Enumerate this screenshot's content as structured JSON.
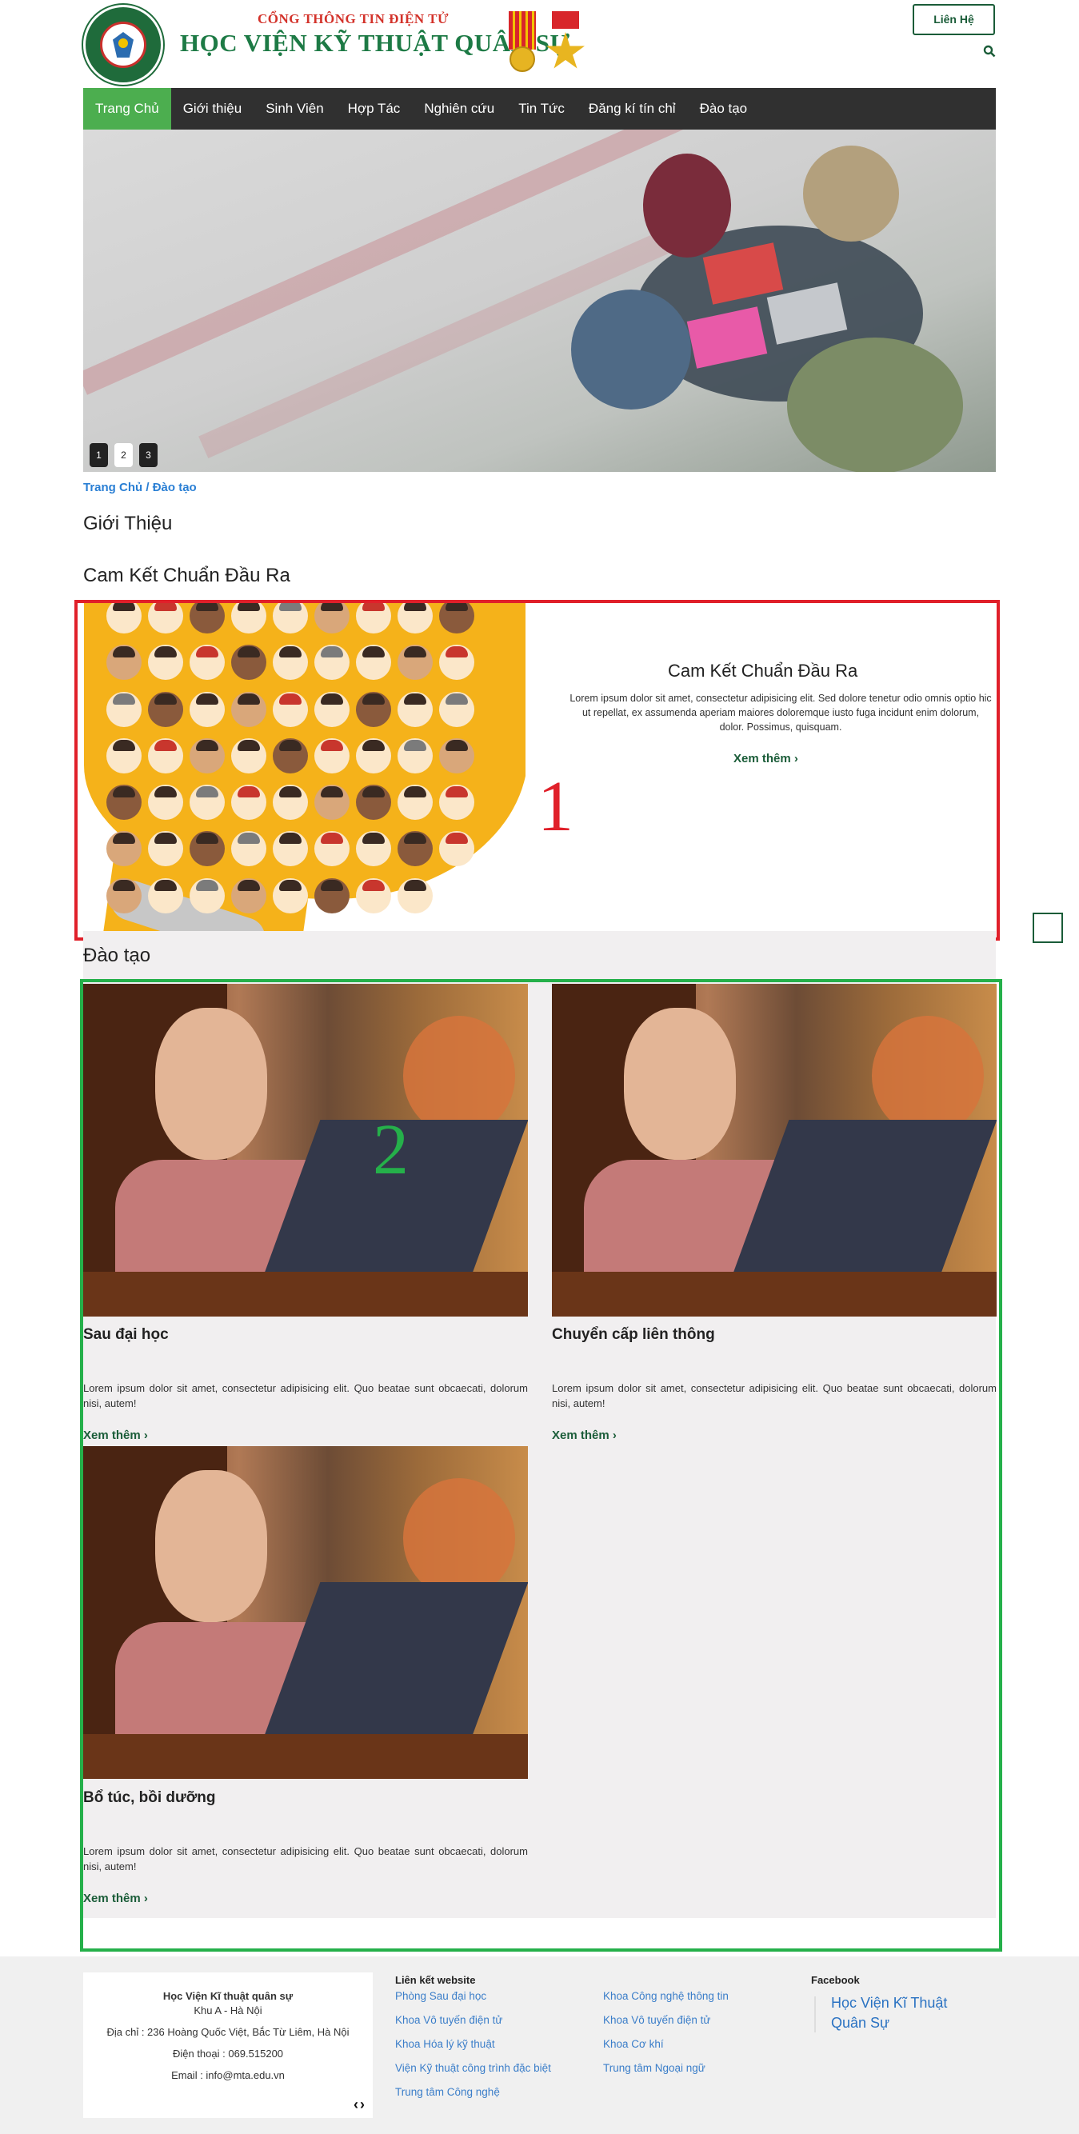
{
  "header": {
    "portal_subtitle": "CỔNG THÔNG TIN ĐIỆN TỬ",
    "portal_title": "HỌC VIỆN KỸ THUẬT QUÂN SỰ",
    "contact_button": "Liên Hệ",
    "search_icon": "search-icon"
  },
  "nav": {
    "items": [
      "Trang Chủ",
      "Giới thiệu",
      "Sinh Viên",
      "Hợp Tác",
      "Nghiên cứu",
      "Tin Tức",
      "Đăng kí tín chỉ",
      "Đào tạo"
    ],
    "active_index": 0,
    "active_color": "#4cae4f",
    "bar_color": "#303030"
  },
  "slider": {
    "pages": [
      "1",
      "2",
      "3"
    ]
  },
  "breadcrumb": {
    "home": "Trang Chủ",
    "separator": "/",
    "current": "Đào tạo"
  },
  "sections": {
    "intro_heading": "Giới Thiệu",
    "commit_heading": "Cam Kết Chuẩn Đầu Ra",
    "training_heading": "Đào tạo"
  },
  "commitment": {
    "title": "Cam Kết Chuẩn Đầu Ra",
    "text": "Lorem ipsum dolor sit amet, consectetur adipisicing elit. Sed dolore tenetur odio omnis optio hic ut repellat, ex assumenda aperiam maiores doloremque iusto fuga incidunt enim dolorum, dolor. Possimus, quisquam.",
    "more": "Xem thêm",
    "annotation": "1",
    "border_color": "#e0202a"
  },
  "training": {
    "annotation": "2",
    "border_color": "#25b04a",
    "cards": [
      {
        "title": "Sau đại học",
        "text": "Lorem ipsum dolor sit amet, consectetur adipisicing elit. Quo beatae sunt obcaecati, dolorum nisi, autem!",
        "more": "Xem thêm"
      },
      {
        "title": "Chuyển cấp liên thông",
        "text": "Lorem ipsum dolor sit amet, consectetur adipisicing elit. Quo beatae sunt obcaecati, dolorum nisi, autem!",
        "more": "Xem thêm"
      },
      {
        "title": "Bổ túc, bồi dưỡng",
        "text": "Lorem ipsum dolor sit amet, consectetur adipisicing elit. Quo beatae sunt obcaecati, dolorum nisi, autem!",
        "more": "Xem thêm"
      }
    ]
  },
  "footer": {
    "org_name": "Học Viện Kĩ thuật quân sự",
    "campus": "Khu A - Hà Nội",
    "address": "Địa chỉ : 236 Hoàng Quốc Việt, Bắc Từ Liêm, Hà Nội",
    "phone": "Điện thoại : 069.515200",
    "email": "Email : info@mta.edu.vn",
    "links_title": "Liên kết website",
    "links_col1": [
      "Phòng Sau đại học",
      "Khoa Vô tuyến điện tử",
      "Khoa Hóa lý kỹ thuật",
      "Viện Kỹ thuật công trình đặc biệt",
      "Trung tâm Công nghệ"
    ],
    "links_col2": [
      "Khoa Công nghệ thông tin",
      "Khoa Vô tuyến điện tử",
      "Khoa Cơ khí",
      "Trung tâm Ngoại ngữ"
    ],
    "facebook_title": "Facebook",
    "facebook_link": "Học Viện Kĩ Thuật Quân Sự"
  }
}
